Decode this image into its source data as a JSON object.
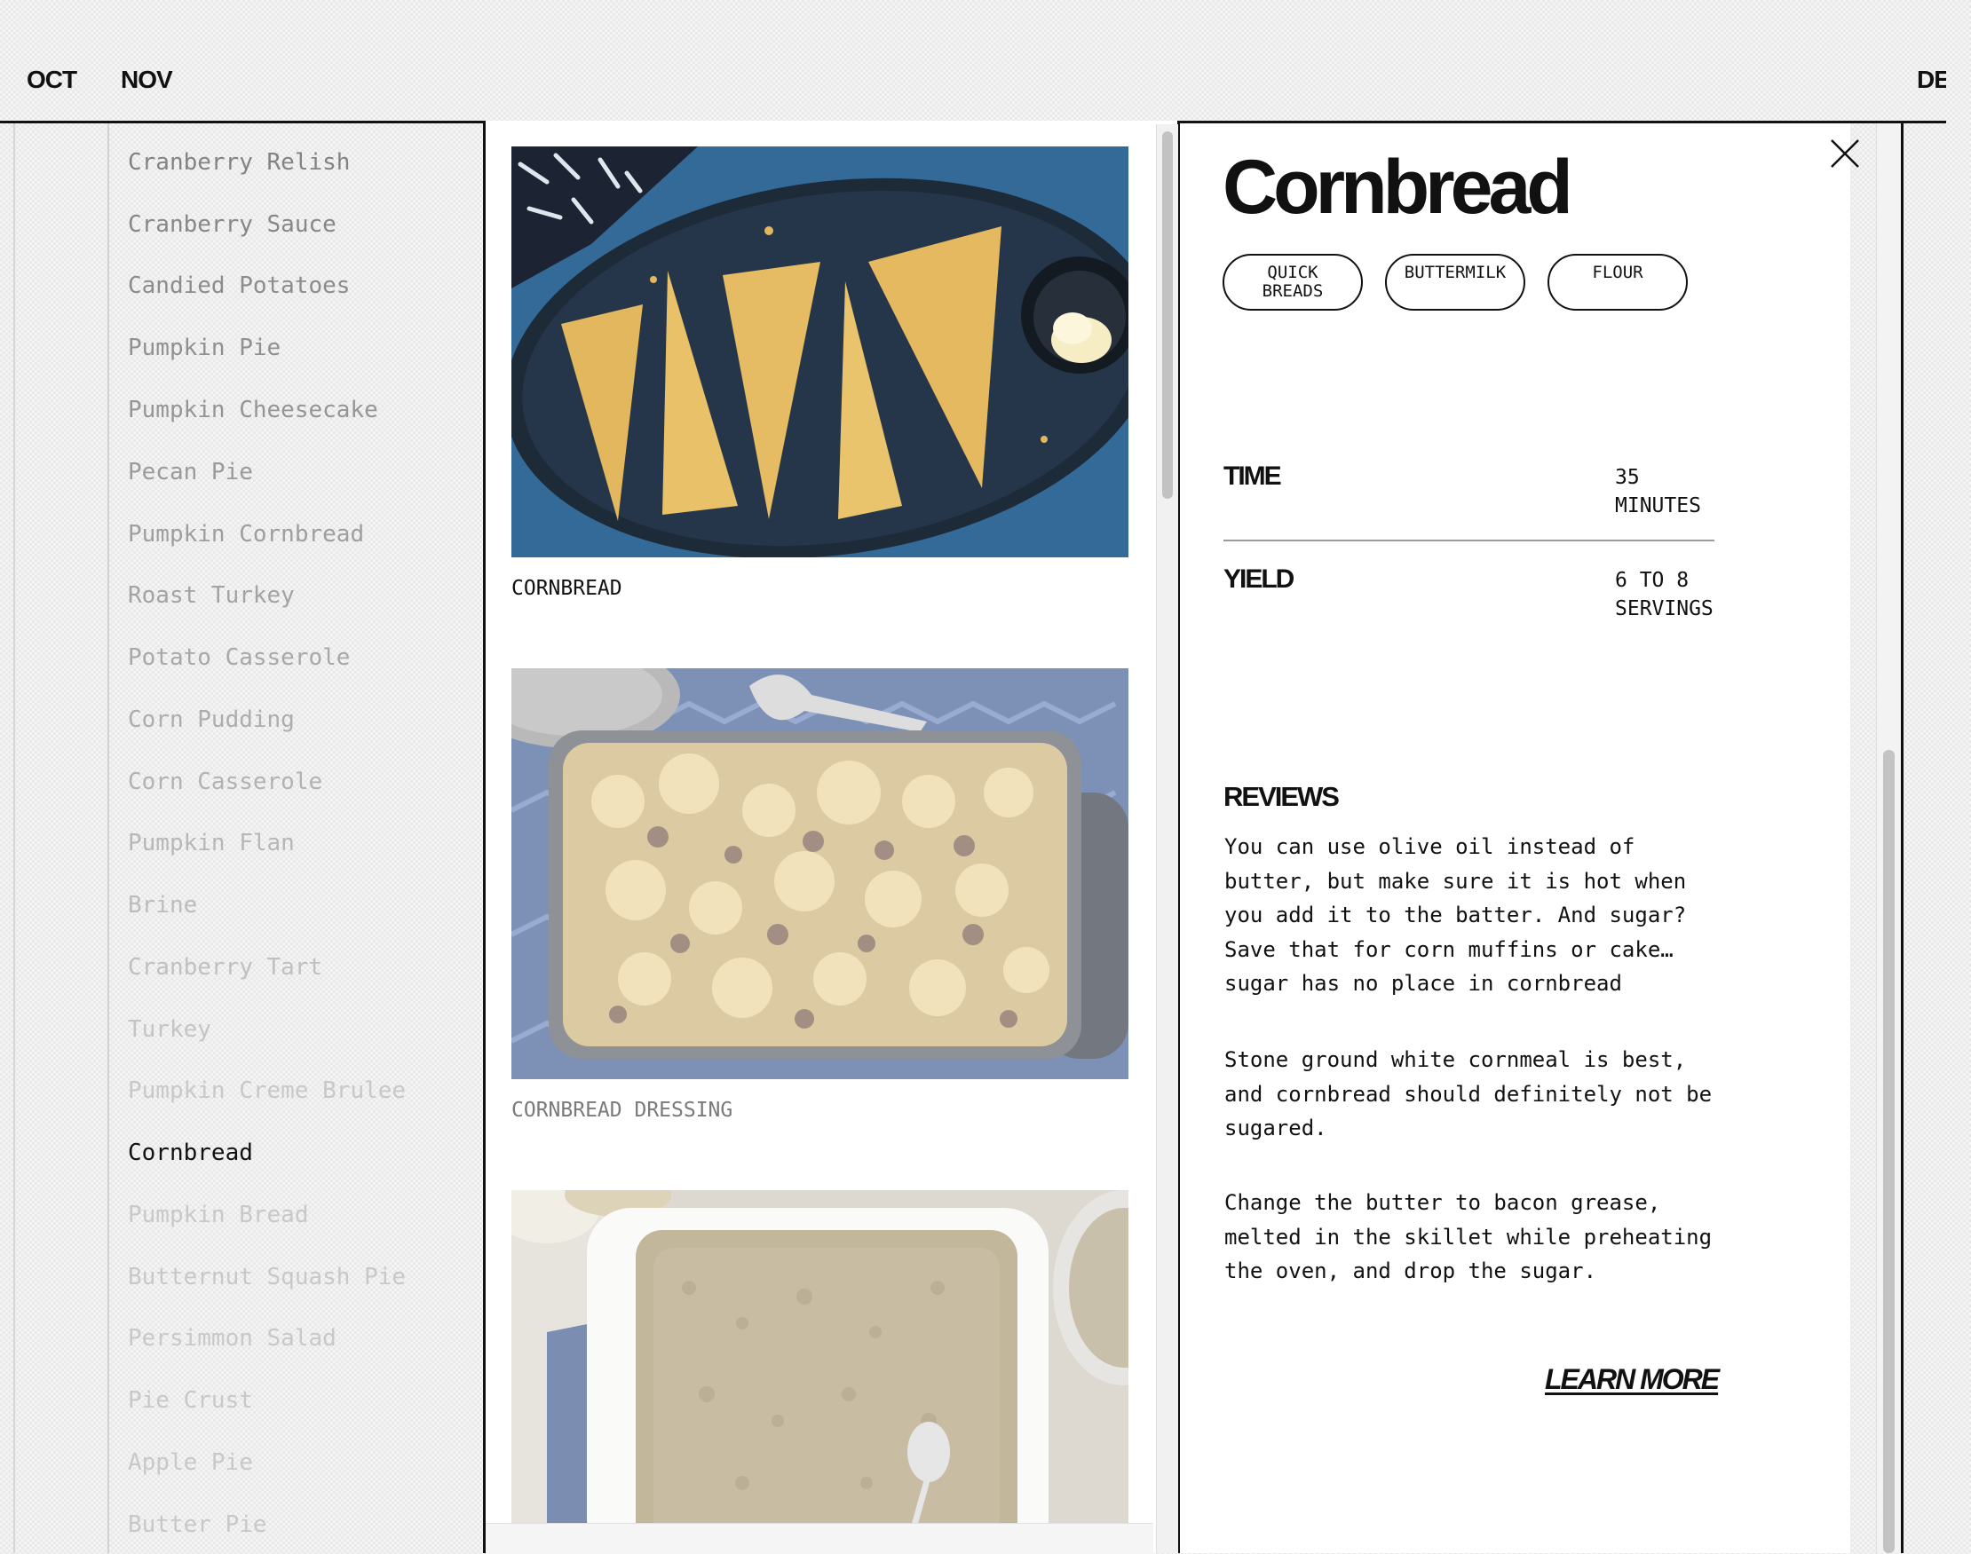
{
  "months": [
    {
      "label": "OCT"
    },
    {
      "label": "NOV"
    },
    {
      "label": "DE"
    }
  ],
  "sidebar": {
    "items": [
      {
        "label": "Cranberry Relish",
        "color": "#838383"
      },
      {
        "label": "Cranberry Sauce",
        "color": "#878787"
      },
      {
        "label": "Candied Potatoes",
        "color": "#8c8c8c"
      },
      {
        "label": "Pumpkin Pie",
        "color": "#909090"
      },
      {
        "label": "Pumpkin Cheesecake",
        "color": "#959595"
      },
      {
        "label": "Pecan Pie",
        "color": "#9a9a9a"
      },
      {
        "label": "Pumpkin Cornbread",
        "color": "#9e9e9e"
      },
      {
        "label": "Roast Turkey",
        "color": "#a3a3a3"
      },
      {
        "label": "Potato Casserole",
        "color": "#a8a8a8"
      },
      {
        "label": "Corn Pudding",
        "color": "#adadad"
      },
      {
        "label": "Corn Casserole",
        "color": "#b2b2b2"
      },
      {
        "label": "Pumpkin Flan",
        "color": "#b7b7b7"
      },
      {
        "label": "Brine",
        "color": "#bcbcbc"
      },
      {
        "label": "Cranberry Tart",
        "color": "#c0c0c0"
      },
      {
        "label": "Turkey",
        "color": "#c4c4c4"
      },
      {
        "label": "Pumpkin Creme Brulee",
        "color": "#c8c8c8"
      },
      {
        "label": "Cornbread",
        "color": "#111111"
      },
      {
        "label": "Pumpkin Bread",
        "color": "#c8c8c8"
      },
      {
        "label": "Butternut Squash Pie",
        "color": "#c8c8c8"
      },
      {
        "label": "Persimmon Salad",
        "color": "#c8c8c8"
      },
      {
        "label": "Pie Crust",
        "color": "#c8c8c8"
      },
      {
        "label": "Apple Pie",
        "color": "#c8c8c8"
      },
      {
        "label": "Butter Pie",
        "color": "#c8c8c8"
      }
    ]
  },
  "gallery": {
    "cards": [
      {
        "label": "CORNBREAD",
        "color": "#111111"
      },
      {
        "label": "CORNBREAD DRESSING",
        "color": "#7a7a7a"
      },
      {
        "label": "",
        "color": "#7a7a7a"
      }
    ]
  },
  "detail": {
    "title": "Cornbread",
    "tags": [
      {
        "line1": "QUICK",
        "line2": "BREADS"
      },
      {
        "line1": "BUTTERMILK",
        "line2": ""
      },
      {
        "line1": "FLOUR",
        "line2": ""
      }
    ],
    "time": {
      "label": "TIME",
      "line1": "35",
      "line2": "MINUTES"
    },
    "yield": {
      "label": "YIELD",
      "line1": "6 TO 8",
      "line2": "SERVINGS"
    },
    "reviews_heading": "REVIEWS",
    "reviews": [
      "You can use olive oil instead of butter, but make sure it is hot when you add it to the batter. And sugar? Save that for corn muffins or cake… sugar has no place in cornbread",
      "Stone ground white cornmeal is best, and cornbread should definitely not be sugared.",
      "Change the butter to bacon grease, melted in the skillet while preheating the oven, and drop the sugar."
    ],
    "learn_more": "LEARN MORE"
  },
  "icons": {
    "close": "close-icon"
  }
}
